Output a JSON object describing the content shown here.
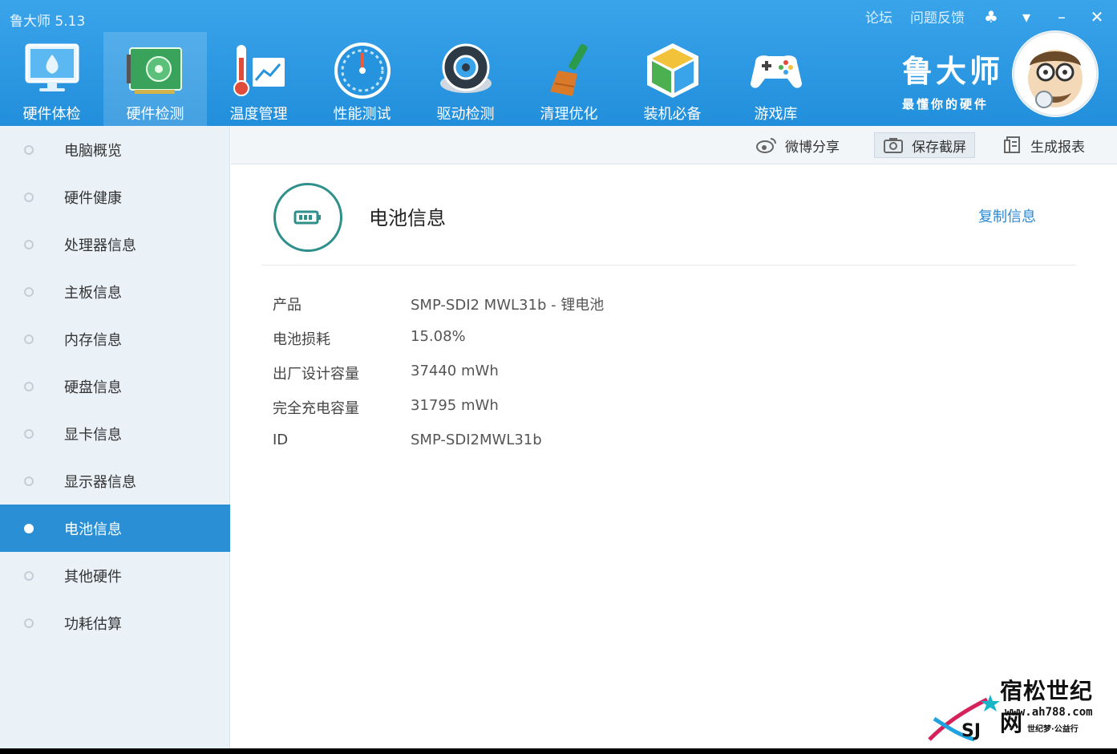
{
  "app": {
    "title": "鲁大师 5.13",
    "top_links": [
      "论坛",
      "问题反馈"
    ],
    "controls": {
      "skin": "♣",
      "menu": "▾",
      "minimize": "–",
      "close": "✕"
    }
  },
  "nav": [
    {
      "label": "硬件体检",
      "icon": "monitor-icon",
      "active": false
    },
    {
      "label": "硬件检测",
      "icon": "chip-icon",
      "active": true
    },
    {
      "label": "温度管理",
      "icon": "thermometer-icon",
      "active": false
    },
    {
      "label": "性能测试",
      "icon": "gauge-icon",
      "active": false
    },
    {
      "label": "驱动检测",
      "icon": "gear-icon",
      "active": false
    },
    {
      "label": "清理优化",
      "icon": "broom-icon",
      "active": false
    },
    {
      "label": "装机必备",
      "icon": "box-icon",
      "active": false
    },
    {
      "label": "游戏库",
      "icon": "gamepad-icon",
      "active": false
    }
  ],
  "brand": {
    "name": "鲁大师",
    "slogan": "最懂你的硬件"
  },
  "sidebar": {
    "items": [
      {
        "label": "电脑概览",
        "active": false
      },
      {
        "label": "硬件健康",
        "active": false
      },
      {
        "label": "处理器信息",
        "active": false
      },
      {
        "label": "主板信息",
        "active": false
      },
      {
        "label": "内存信息",
        "active": false
      },
      {
        "label": "硬盘信息",
        "active": false
      },
      {
        "label": "显卡信息",
        "active": false
      },
      {
        "label": "显示器信息",
        "active": false
      },
      {
        "label": "电池信息",
        "active": true
      },
      {
        "label": "其他硬件",
        "active": false
      },
      {
        "label": "功耗估算",
        "active": false
      }
    ]
  },
  "toolbar": {
    "weibo_share": "微博分享",
    "save_screenshot": "保存截屏",
    "generate_report": "生成报表"
  },
  "battery": {
    "section_title": "电池信息",
    "copy_info": "复制信息",
    "rows": [
      {
        "key": "产品",
        "value": "SMP-SDI2 MWL31b -   锂电池"
      },
      {
        "key": "电池损耗",
        "value": "15.08%"
      },
      {
        "key": "出厂设计容量",
        "value": "37440 mWh"
      },
      {
        "key": "完全充电容量",
        "value": "31795 mWh"
      },
      {
        "key": "ID",
        "value": " SMP-SDI2MWL31b"
      }
    ]
  },
  "watermark": {
    "title": "宿松世纪网",
    "url": "www.ah788.com",
    "slogan": "世纪梦·公益行",
    "logo_text": "SJ"
  },
  "colors": {
    "topbar": "#2593dd",
    "active_item": "#2b8fd6",
    "link": "#2a8ad6",
    "battery_ring": "#2f8f8a"
  }
}
